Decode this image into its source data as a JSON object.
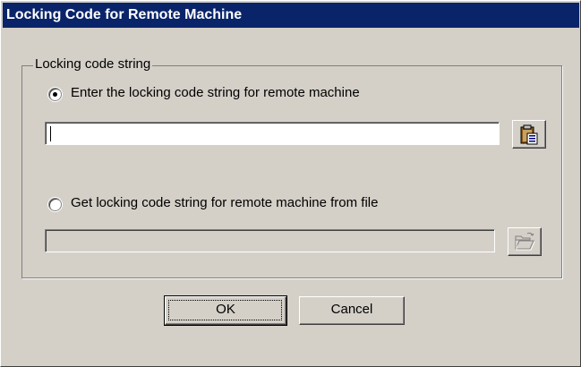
{
  "dialog": {
    "title": "Locking Code for Remote Machine"
  },
  "group": {
    "label": "Locking code string"
  },
  "option_enter": {
    "label": "Enter the locking code string for remote machine",
    "selected": true,
    "input_value": ""
  },
  "option_file": {
    "label": "Get locking code string for remote machine from file",
    "selected": false,
    "input_value": ""
  },
  "icons": {
    "paste": "clipboard-paste-icon",
    "browse": "open-folder-icon"
  },
  "buttons": {
    "ok": "OK",
    "cancel": "Cancel"
  },
  "colors": {
    "titlebar": "#0a246a",
    "face": "#d4d0c8"
  }
}
